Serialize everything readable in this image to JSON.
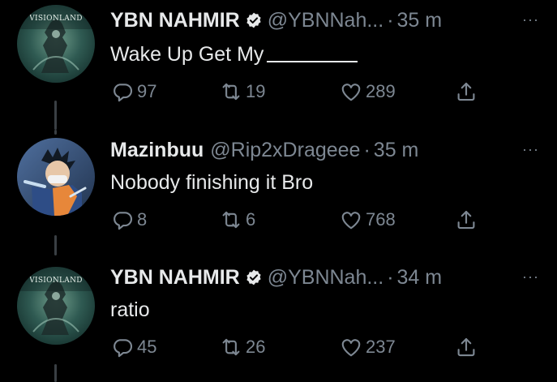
{
  "tweets": [
    {
      "name": "YBN NAHMIR",
      "verified": true,
      "handle": "@YBNNah...",
      "time": "35 m",
      "text": "Wake Up Get My",
      "has_blank": true,
      "replies": "97",
      "retweets": "19",
      "likes": "289",
      "avatar_logo": "VISIONLAND"
    },
    {
      "name": "Mazinbuu",
      "verified": false,
      "handle": "@Rip2xDrageee",
      "time": "35 m",
      "text": "Nobody finishing it Bro",
      "has_blank": false,
      "replies": "8",
      "retweets": "6",
      "likes": "768"
    },
    {
      "name": "YBN NAHMIR",
      "verified": true,
      "handle": "@YBNNah...",
      "time": "34 m",
      "text": "ratio",
      "has_blank": false,
      "replies": "45",
      "retweets": "26",
      "likes": "237",
      "avatar_logo": "VISIONLAND"
    }
  ],
  "separator_dot": "·",
  "more_glyph": "···",
  "colors": {
    "background": "#000000",
    "primary_text": "#e7e9ea",
    "secondary_text": "#7d8792",
    "thread_line": "#3a3f44"
  },
  "icons": {
    "reply": "reply-icon",
    "retweet": "retweet-icon",
    "like": "heart-icon",
    "share": "share-icon",
    "verified": "verified-badge-icon",
    "more": "more-options-icon"
  }
}
